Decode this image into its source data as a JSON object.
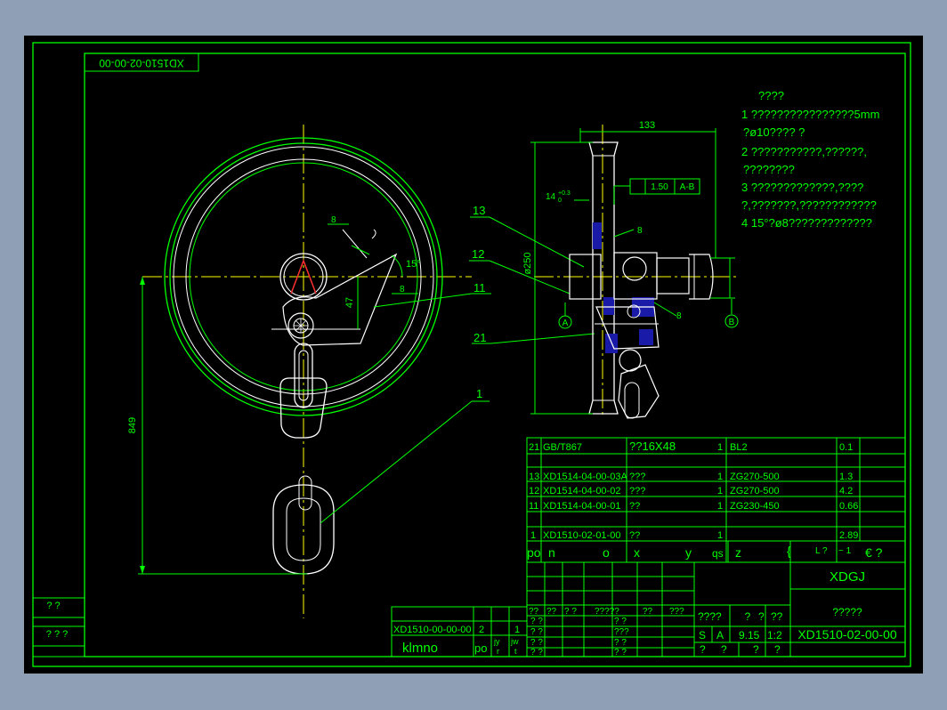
{
  "drawing_number_rotated": "XD1510-02-00-00",
  "notes": {
    "heading": "????",
    "lines": [
      "1 ????????????????5mm",
      "?ø10???? ?",
      "2 ???????????,??????,",
      "????????",
      "3 ?????????????,????",
      "?,???????,????????????",
      "4 15°?ø8?????????????"
    ]
  },
  "dimensions": {
    "d133": "133",
    "d250": "ø250",
    "d849": "849",
    "d47": "47",
    "d15": "15°",
    "d14": "14",
    "d14tol_top": "+0.3",
    "d14tol_bot": "0",
    "weld1": "8",
    "weld2": "8",
    "weld3": "8",
    "weld4": "8",
    "tol_value": "1.50",
    "tol_ref": "A-B",
    "datum_a": "A",
    "datum_b": "B"
  },
  "balloons": [
    "13",
    "12",
    "11",
    "21",
    "1"
  ],
  "bom": {
    "rows": [
      {
        "no": "21",
        "code": "GB/T867",
        "name": "??16X48",
        "qty": "1",
        "mat": "BL2",
        "w1": "0.1"
      },
      {
        "no": "13",
        "code": "XD1514-04-00-03A",
        "name": "???",
        "qty": "1",
        "mat": "ZG270-500",
        "w1": "1.3"
      },
      {
        "no": "12",
        "code": "XD1514-04-00-02",
        "name": "???",
        "qty": "1",
        "mat": "ZG270-500",
        "w1": "4.2"
      },
      {
        "no": "11",
        "code": "XD1514-04-00-01",
        "name": "??",
        "qty": "1",
        "mat": "ZG230-450",
        "w1": "0.66"
      },
      {
        "no": "1",
        "code": "XD1510-02-01-00",
        "name": "??",
        "qty": "1",
        "mat": "",
        "w1": "2.89"
      }
    ],
    "header": [
      "po",
      "n",
      "o",
      "x",
      "y",
      "qs",
      "z",
      "{",
      "L ?",
      "~ 1",
      "€ ?"
    ]
  },
  "title_block": {
    "company": "XDGJ",
    "part_name": "?????",
    "drawing_no": "XD1510-02-00-00",
    "scale": "1:2",
    "weight": "9.15",
    "stage": "S",
    "stage2": "A",
    "label_a": "????",
    "label_b": "?",
    "label_c": "?",
    "label_d": "??",
    "bottom": [
      "?",
      "?",
      "?",
      "?"
    ],
    "sign_header": [
      "??",
      "??",
      "? ?",
      "?????",
      "??",
      "???"
    ],
    "sign_rows": [
      "? ?",
      "? ?",
      "? ?",
      "? ?"
    ],
    "sign_rows2": [
      "? ?",
      "???",
      "? ?",
      "? ?"
    ]
  },
  "assembly": {
    "code": "XD1510-00-00-00",
    "qty": "2",
    "qty2": "1",
    "label": "klmno",
    "cols": [
      "po",
      "jy",
      "jw"
    ],
    "sub": [
      "r",
      "t"
    ]
  },
  "left_side": [
    "?  ?",
    "? ? ?"
  ],
  "colors": {
    "line": "#00ff00",
    "centerline": "#ffff00",
    "blue": "#1a1aa8",
    "red": "#ff3030",
    "white": "#ffffff"
  }
}
